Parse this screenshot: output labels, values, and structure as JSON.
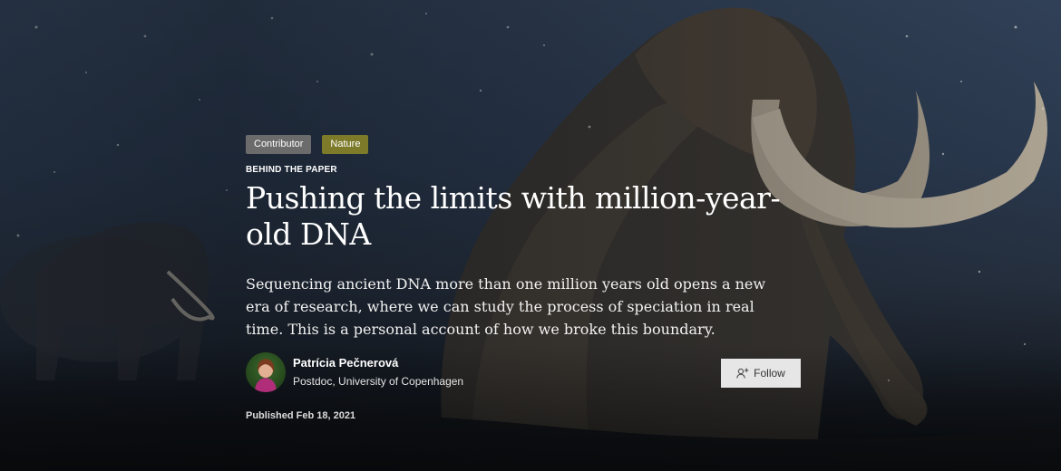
{
  "tags": {
    "contributor": "Contributor",
    "nature": "Nature"
  },
  "kicker": "BEHIND THE PAPER",
  "title": "Pushing the limits with million-year-old DNA",
  "dek": "Sequencing ancient DNA more than one million years old opens a new era of research, where we can study the process of speciation in real time. This is a personal account of how we broke this boundary.",
  "author": {
    "name": "Patrícia Pečnerová",
    "affiliation": "Postdoc, University of Copenhagen"
  },
  "follow": {
    "label": "Follow",
    "icon": "add-user-icon"
  },
  "published": "Published Feb 18, 2021",
  "colors": {
    "tag_contributor": "#6b6b6b",
    "tag_nature": "#7d7a2a",
    "follow_bg": "#e6e6e6"
  }
}
